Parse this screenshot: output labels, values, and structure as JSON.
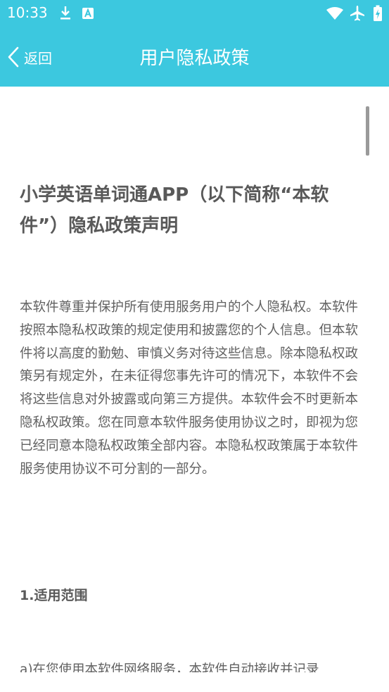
{
  "status_bar": {
    "time": "10:33",
    "icons": [
      "download-icon",
      "app-notification-icon",
      "wifi-icon",
      "airplane-icon",
      "battery-icon"
    ]
  },
  "header": {
    "back_label": "返回",
    "title": "用户隐私政策",
    "background_color": "#3cc8df"
  },
  "document": {
    "title": "小学英语单词通APP（以下简称“本软件”）隐私政策声明",
    "intro": "本软件尊重并保护所有使用服务用户的个人隐私权。本软件按照本隐私权政策的规定使用和披露您的个人信息。但本软件将以高度的勤勉、审慎义务对待这些信息。除本隐私权政策另有规定外，在未征得您事先许可的情况下，本软件不会将这些信息对外披露或向第三方提供。本软件会不时更新本隐私权政策。您在同意本软件服务使用协议之时，即视为您已经同意本隐私权政策全部内容。本隐私权政策属于本软件服务使用协议不可分割的一部分。",
    "section_1_heading": "1.适用范围",
    "section_1_partial": "a)在您使用本软件网络服务，本软件自动接收并记录"
  }
}
